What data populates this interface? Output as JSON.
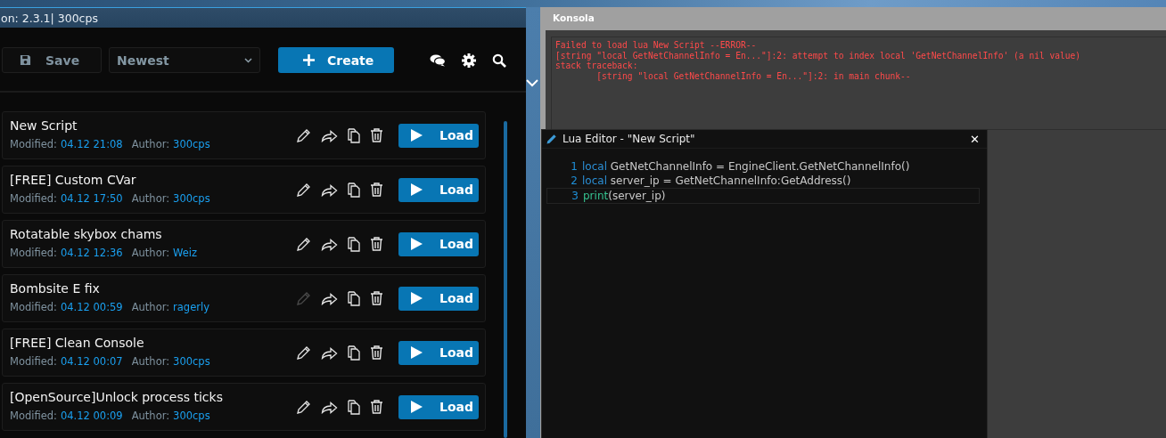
{
  "main_window": {
    "title": "on: 2.3.1| 300cps"
  },
  "toolbar": {
    "save": "Save",
    "sort": "Newest",
    "create": "Create"
  },
  "scripts": [
    {
      "name": "New Script",
      "modified_label": "Modified:",
      "modified": "04.12 21:08",
      "author_label": "Author:",
      "author": "300cps",
      "edit_disabled": false,
      "load": "Load"
    },
    {
      "name": "[FREE] Custom CVar",
      "modified_label": "Modified:",
      "modified": "04.12 17:50",
      "author_label": "Author:",
      "author": "300cps",
      "edit_disabled": false,
      "load": "Load"
    },
    {
      "name": "Rotatable skybox chams",
      "modified_label": "Modified:",
      "modified": "04.12 12:36",
      "author_label": "Author:",
      "author": "Weiz",
      "edit_disabled": false,
      "load": "Load"
    },
    {
      "name": "Bombsite E fix",
      "modified_label": "Modified:",
      "modified": "04.12 00:59",
      "author_label": "Author:",
      "author": "ragerly",
      "edit_disabled": true,
      "load": "Load"
    },
    {
      "name": "[FREE] Clean Console",
      "modified_label": "Modified:",
      "modified": "04.12 00:07",
      "author_label": "Author:",
      "author": "300cps",
      "edit_disabled": false,
      "load": "Load"
    },
    {
      "name": "[OpenSource]Unlock process ticks",
      "modified_label": "Modified:",
      "modified": "04.12 00:09",
      "author_label": "Author:",
      "author": "300cps",
      "edit_disabled": false,
      "load": "Load"
    }
  ],
  "console": {
    "title": "Konsola",
    "lines": [
      "Failed to load lua New Script --ERROR--",
      "[string \"local GetNetChannelInfo = En...\"]:2: attempt to index local 'GetNetChannelInfo' (a nil value)",
      "stack traceback:",
      "        [string \"local GetNetChannelInfo = En...\"]:2: in main chunk--"
    ]
  },
  "editor": {
    "title": "Lua Editor - \"New Script\"",
    "close": "✕",
    "lines": [
      {
        "number": "1",
        "current": false,
        "tokens": [
          {
            "kind": "keyword",
            "text": "local"
          },
          {
            "kind": "plain",
            "text": " GetNetChannelInfo = EngineClient.GetNetChannelInfo()"
          }
        ]
      },
      {
        "number": "2",
        "current": false,
        "tokens": [
          {
            "kind": "keyword",
            "text": "local"
          },
          {
            "kind": "plain",
            "text": " server_ip = GetNetChannelInfo:GetAddress()"
          }
        ]
      },
      {
        "number": "3",
        "current": true,
        "tokens": [
          {
            "kind": "builtin",
            "text": "print"
          },
          {
            "kind": "plain",
            "text": "(server_ip)"
          }
        ]
      }
    ]
  }
}
